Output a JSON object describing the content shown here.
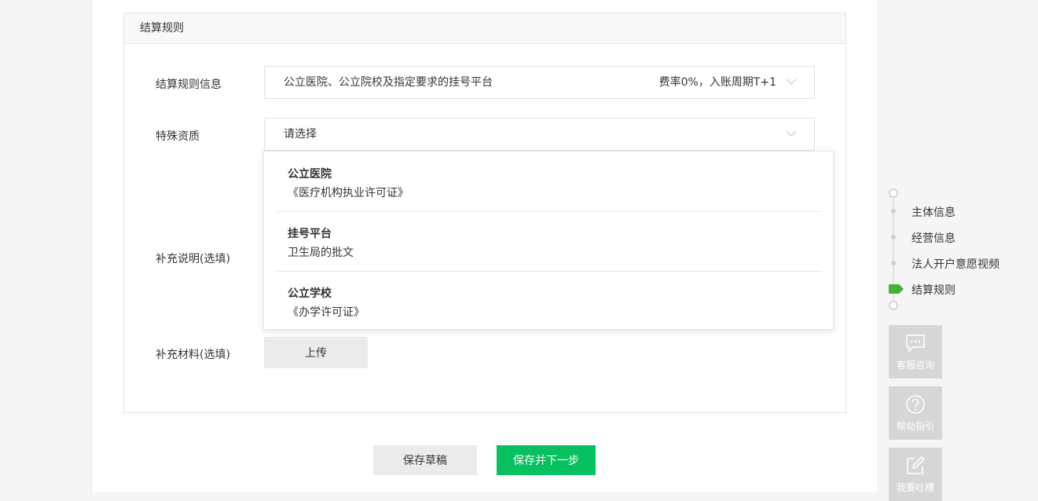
{
  "panel": {
    "title": "结算规则"
  },
  "rule_info": {
    "label": "结算规则信息",
    "value": "公立医院、公立院校及指定要求的挂号平台",
    "rate": "费率0%，入账周期T+1"
  },
  "qualification": {
    "label": "特殊资质",
    "placeholder": "请选择",
    "options": [
      {
        "title": "公立医院",
        "desc": "《医疗机构执业许可证》"
      },
      {
        "title": "挂号平台",
        "desc": "卫生局的批文"
      },
      {
        "title": "公立学校",
        "desc": "《办学许可证》"
      }
    ]
  },
  "supplement_desc": {
    "label": "补充说明(选填)"
  },
  "supplement_material": {
    "label": "补充材料(选填)",
    "upload_label": "上传"
  },
  "actions": {
    "save_draft": "保存草稿",
    "save_next": "保存并下一步"
  },
  "steps": [
    {
      "label": "主体信息",
      "active": false
    },
    {
      "label": "经营信息",
      "active": false
    },
    {
      "label": "法人开户意愿视频",
      "active": false
    },
    {
      "label": "结算规则",
      "active": true
    }
  ],
  "side_buttons": [
    {
      "label": "客服咨询",
      "icon": "chat-icon"
    },
    {
      "label": "帮助指引",
      "icon": "question-icon"
    },
    {
      "label": "我要吐槽",
      "icon": "edit-icon"
    }
  ],
  "colors": {
    "primary": "#07c160",
    "step_active": "#45b036"
  }
}
